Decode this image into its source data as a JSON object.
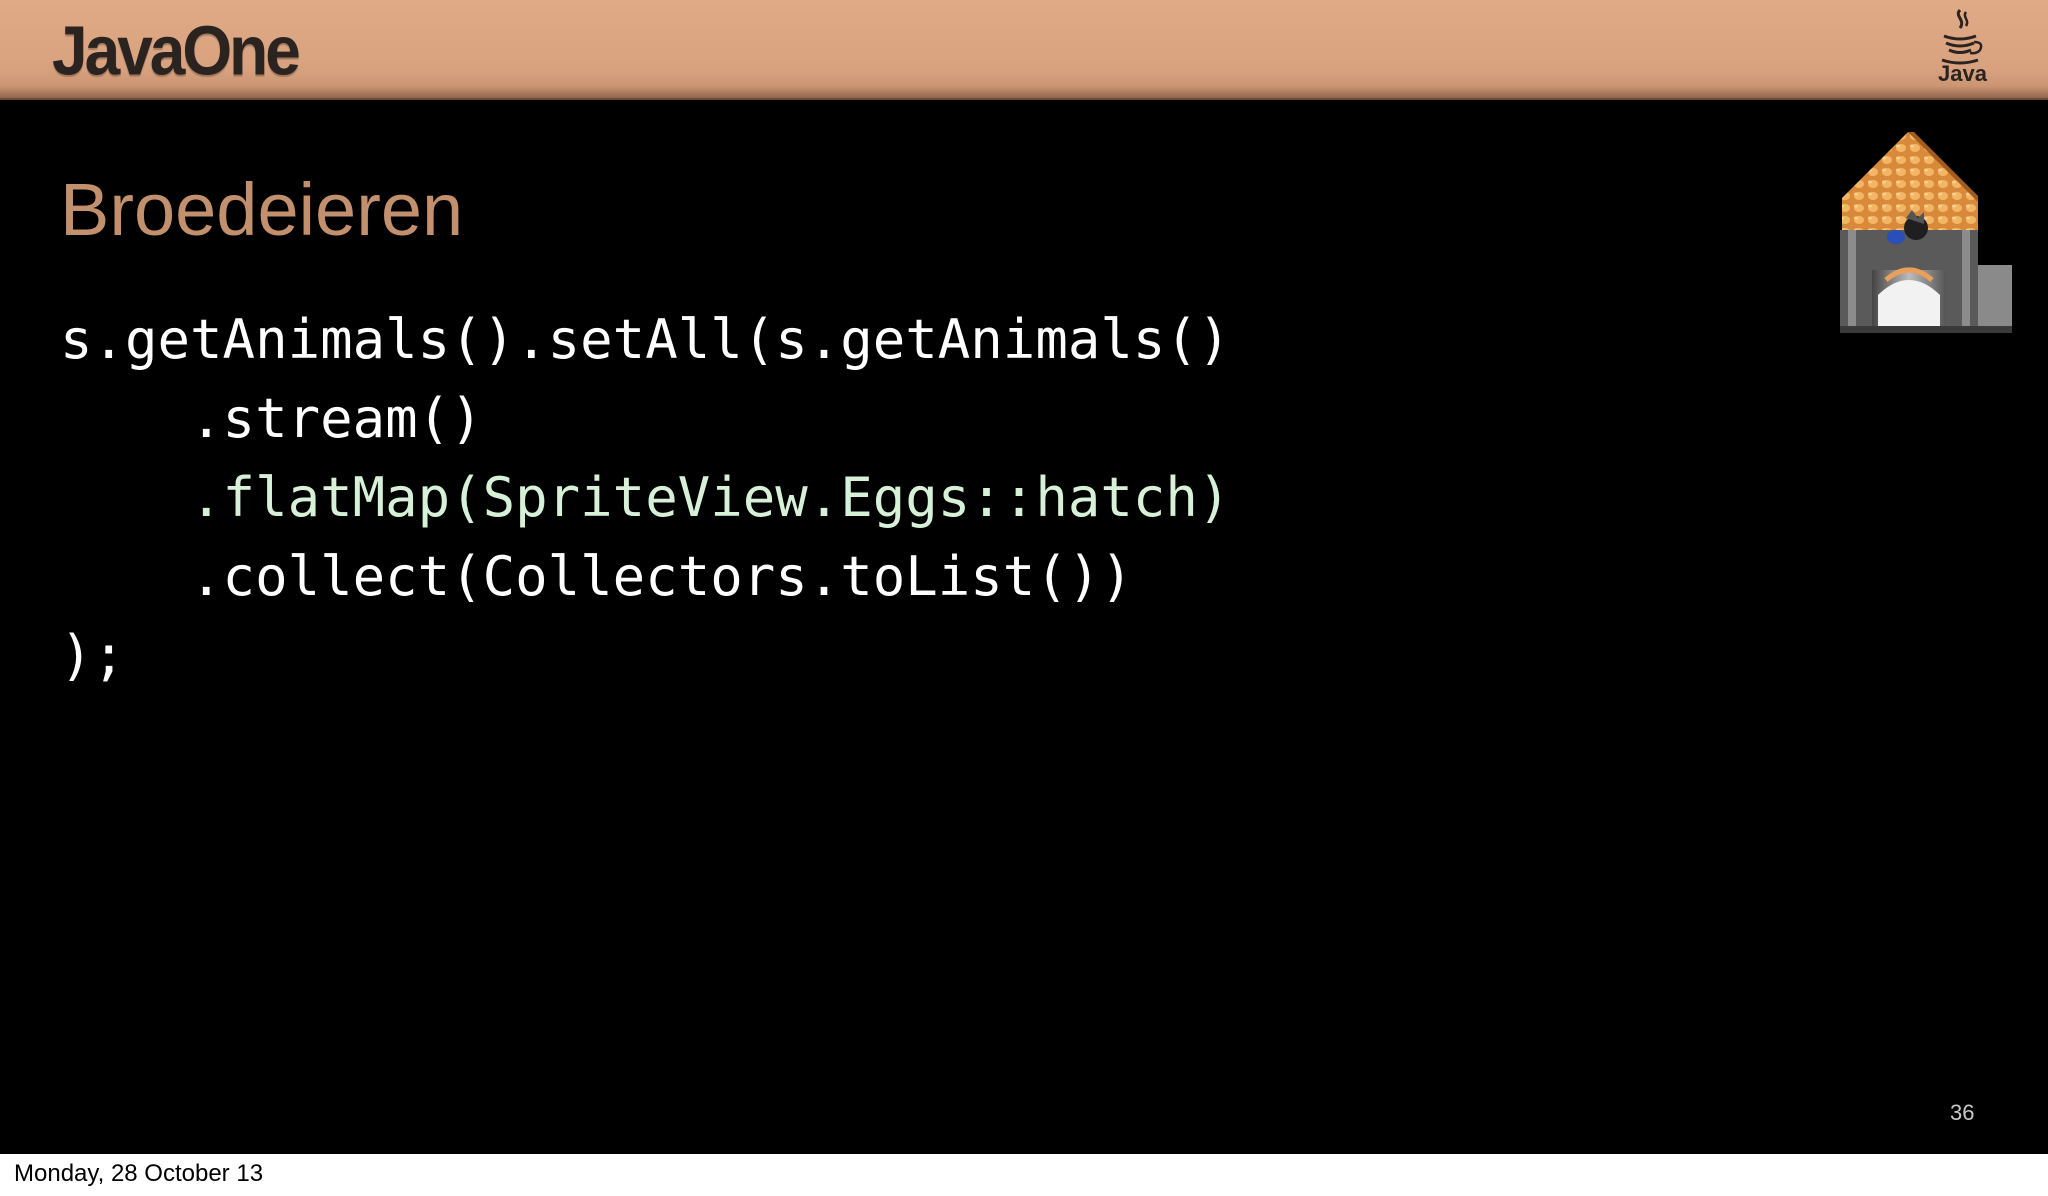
{
  "header": {
    "brand": "JavaOne",
    "java_mark_label": "Java",
    "java_icon": "java-coffee-cup-icon"
  },
  "slide": {
    "title": "Broedeieren",
    "code_lines": [
      "s.getAnimals().setAll(s.getAnimals()",
      "    .stream()",
      "    .flatMap(SpriteView.Eggs::hatch)",
      "    .collect(Collectors.toList())",
      ");"
    ],
    "highlighted_line_index": 2,
    "page_number": "36",
    "image": "chicken-coop-image"
  },
  "footer": {
    "date": "Monday, 28 October 13"
  },
  "colors": {
    "header_band": "#dba682",
    "title": "#c2906c",
    "code_text": "#ffffff",
    "code_highlight": "#d7f0d8",
    "slide_background": "#000000"
  }
}
